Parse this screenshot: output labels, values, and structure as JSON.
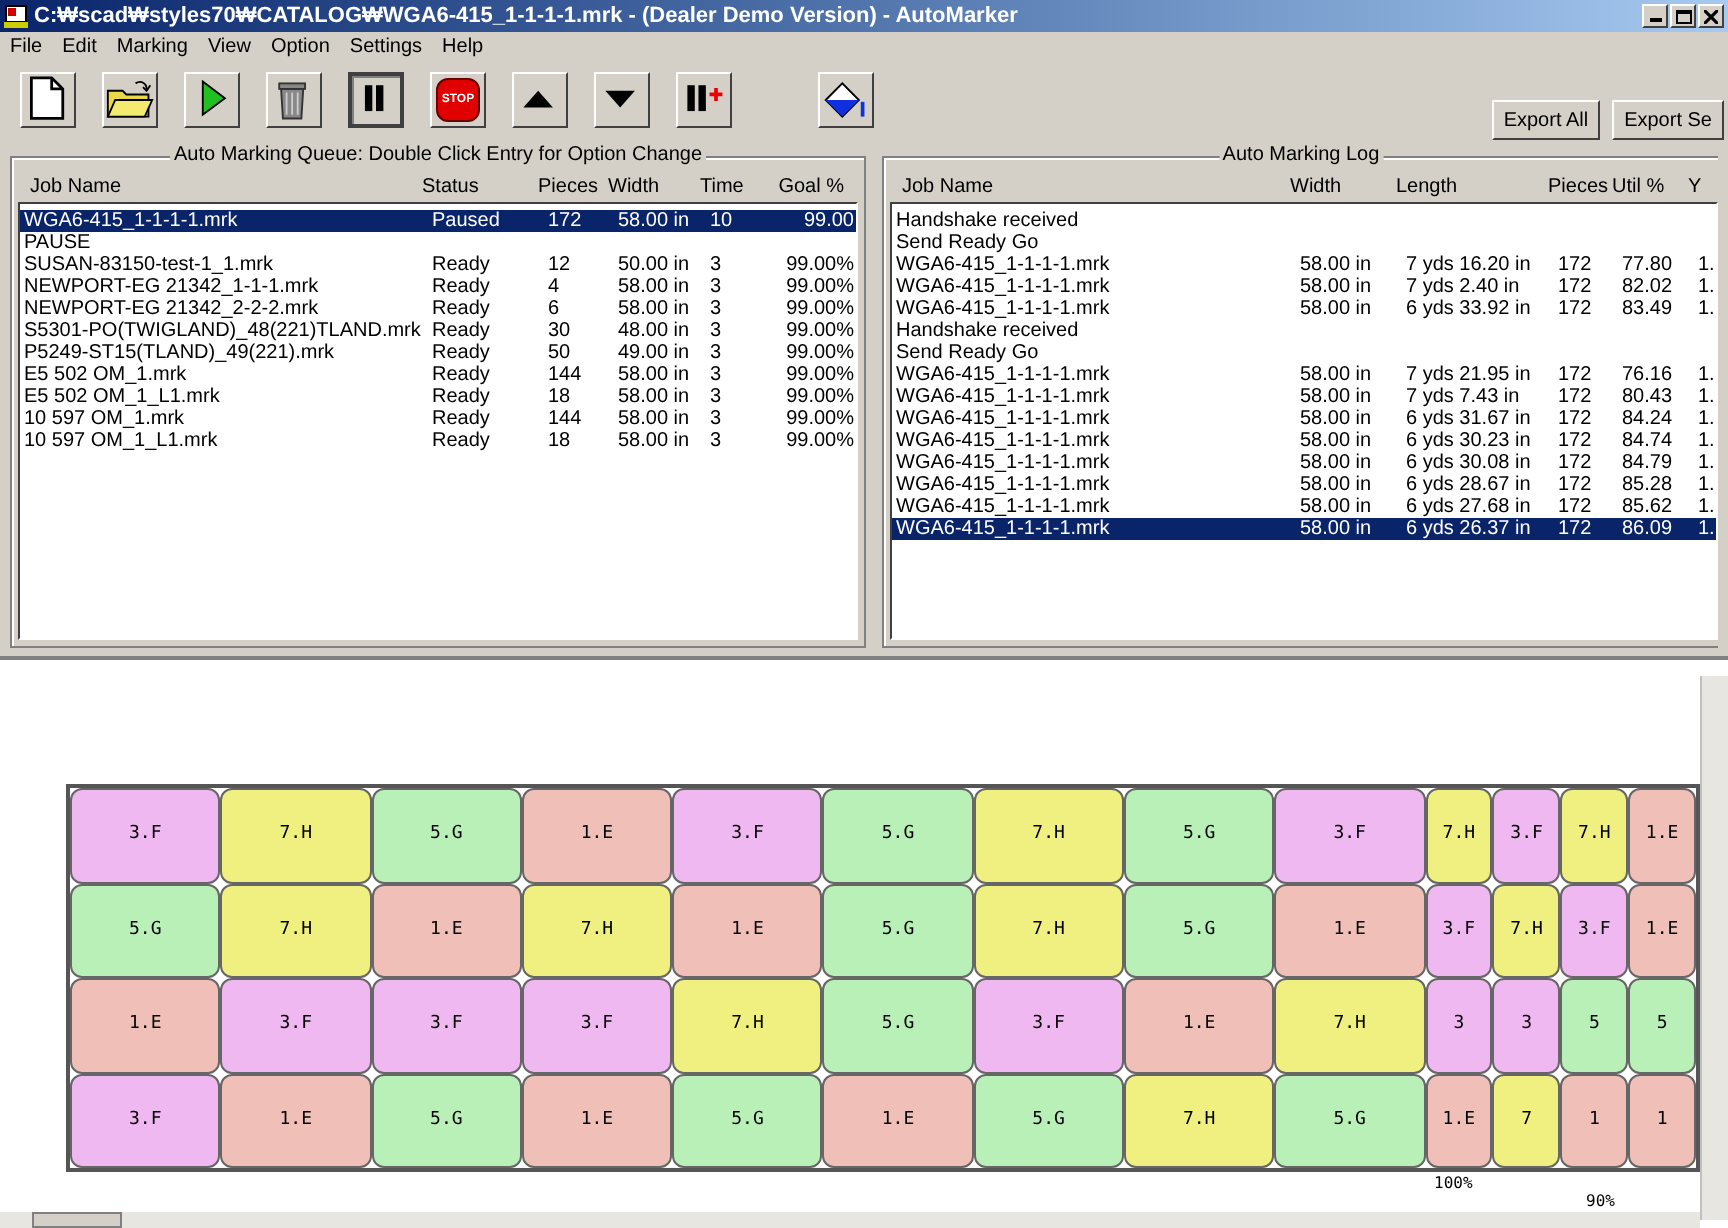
{
  "window": {
    "title": "C:₩scad₩styles70₩CATALOG₩WGA6-415_1-1-1-1.mrk - (Dealer Demo Version) - AutoMarker"
  },
  "menu": [
    "File",
    "Edit",
    "Marking",
    "View",
    "Option",
    "Settings",
    "Help"
  ],
  "toolbar": [
    {
      "kind": "new",
      "pressed": false
    },
    {
      "kind": "open",
      "pressed": false
    },
    {
      "kind": "play",
      "pressed": false
    },
    {
      "kind": "trash",
      "pressed": false
    },
    {
      "kind": "pause",
      "pressed": true
    },
    {
      "kind": "stop",
      "pressed": false,
      "label": "STOP"
    },
    {
      "kind": "up",
      "pressed": false
    },
    {
      "kind": "down",
      "pressed": false
    },
    {
      "kind": "pauseplus",
      "pressed": false
    },
    {
      "kind": "bucket",
      "pressed": false
    }
  ],
  "export_buttons": [
    "Export All",
    "Export Se"
  ],
  "queue": {
    "title": "Auto Marking Queue:  Double Click Entry for Option Change",
    "columns": [
      "Job Name",
      "Status",
      "Pieces",
      "Width",
      "Time",
      "Goal %"
    ],
    "rows": [
      {
        "kind": "job",
        "selected": true,
        "cells": [
          "WGA6-415_1-1-1-1.mrk",
          "Paused",
          "172",
          "58.00 in",
          "10",
          "99.00"
        ]
      },
      {
        "kind": "message",
        "selected": false,
        "cells": [
          "PAUSE"
        ]
      },
      {
        "kind": "job",
        "selected": false,
        "cells": [
          "SUSAN-83150-test-1_1.mrk",
          "Ready",
          "12",
          "50.00 in",
          "3",
          "99.00%"
        ]
      },
      {
        "kind": "job",
        "selected": false,
        "cells": [
          "NEWPORT-EG 21342_1-1-1.mrk",
          "Ready",
          "4",
          "58.00 in",
          "3",
          "99.00%"
        ]
      },
      {
        "kind": "job",
        "selected": false,
        "cells": [
          "NEWPORT-EG 21342_2-2-2.mrk",
          "Ready",
          "6",
          "58.00 in",
          "3",
          "99.00%"
        ]
      },
      {
        "kind": "job",
        "selected": false,
        "cells": [
          "S5301-PO(TWIGLAND)_48(221)TLAND.mrk",
          "Ready",
          "30",
          "48.00 in",
          "3",
          "99.00%"
        ]
      },
      {
        "kind": "job",
        "selected": false,
        "cells": [
          "P5249-ST15(TLAND)_49(221).mrk",
          "Ready",
          "50",
          "49.00 in",
          "3",
          "99.00%"
        ]
      },
      {
        "kind": "job",
        "selected": false,
        "cells": [
          "E5 502 OM_1.mrk",
          "Ready",
          "144",
          "58.00 in",
          "3",
          "99.00%"
        ]
      },
      {
        "kind": "job",
        "selected": false,
        "cells": [
          "E5 502 OM_1_L1.mrk",
          "Ready",
          "18",
          "58.00 in",
          "3",
          "99.00%"
        ]
      },
      {
        "kind": "job",
        "selected": false,
        "cells": [
          "10 597 OM_1.mrk",
          "Ready",
          "144",
          "58.00 in",
          "3",
          "99.00%"
        ]
      },
      {
        "kind": "job",
        "selected": false,
        "cells": [
          "10 597 OM_1_L1.mrk",
          "Ready",
          "18",
          "58.00 in",
          "3",
          "99.00%"
        ]
      }
    ]
  },
  "log": {
    "title": "Auto Marking Log",
    "columns": [
      "Job Name",
      "Width",
      "Length",
      "Pieces",
      "Util %",
      "Y"
    ],
    "rows": [
      {
        "kind": "message",
        "selected": false,
        "cells": [
          "Handshake received"
        ]
      },
      {
        "kind": "message",
        "selected": false,
        "cells": [
          "Send Ready Go"
        ]
      },
      {
        "kind": "job",
        "selected": false,
        "cells": [
          "WGA6-415_1-1-1-1.mrk",
          "58.00 in",
          "7 yds 16.20 in",
          "172",
          "77.80",
          "1."
        ]
      },
      {
        "kind": "job",
        "selected": false,
        "cells": [
          "WGA6-415_1-1-1-1.mrk",
          "58.00 in",
          "7 yds 2.40 in",
          "172",
          "82.02",
          "1."
        ]
      },
      {
        "kind": "job",
        "selected": false,
        "cells": [
          "WGA6-415_1-1-1-1.mrk",
          "58.00 in",
          "6 yds 33.92 in",
          "172",
          "83.49",
          "1."
        ]
      },
      {
        "kind": "message",
        "selected": false,
        "cells": [
          "Handshake received"
        ]
      },
      {
        "kind": "message",
        "selected": false,
        "cells": [
          "Send Ready Go"
        ]
      },
      {
        "kind": "job",
        "selected": false,
        "cells": [
          "WGA6-415_1-1-1-1.mrk",
          "58.00 in",
          "7 yds 21.95 in",
          "172",
          "76.16",
          "1."
        ]
      },
      {
        "kind": "job",
        "selected": false,
        "cells": [
          "WGA6-415_1-1-1-1.mrk",
          "58.00 in",
          "7 yds 7.43 in",
          "172",
          "80.43",
          "1."
        ]
      },
      {
        "kind": "job",
        "selected": false,
        "cells": [
          "WGA6-415_1-1-1-1.mrk",
          "58.00 in",
          "6 yds 31.67 in",
          "172",
          "84.24",
          "1."
        ]
      },
      {
        "kind": "job",
        "selected": false,
        "cells": [
          "WGA6-415_1-1-1-1.mrk",
          "58.00 in",
          "6 yds 30.23 in",
          "172",
          "84.74",
          "1."
        ]
      },
      {
        "kind": "job",
        "selected": false,
        "cells": [
          "WGA6-415_1-1-1-1.mrk",
          "58.00 in",
          "6 yds 30.08 in",
          "172",
          "84.79",
          "1."
        ]
      },
      {
        "kind": "job",
        "selected": false,
        "cells": [
          "WGA6-415_1-1-1-1.mrk",
          "58.00 in",
          "6 yds 28.67 in",
          "172",
          "85.28",
          "1."
        ]
      },
      {
        "kind": "job",
        "selected": false,
        "cells": [
          "WGA6-415_1-1-1-1.mrk",
          "58.00 in",
          "6 yds 27.68 in",
          "172",
          "85.62",
          "1."
        ]
      },
      {
        "kind": "job",
        "selected": true,
        "cells": [
          "WGA6-415_1-1-1-1.mrk",
          "58.00 in",
          "6 yds 26.37 in",
          "172",
          "86.09",
          "1."
        ]
      }
    ]
  },
  "marker": {
    "rows": [
      [
        {
          "label": "3.F",
          "color": "#f0b8f0"
        },
        {
          "label": "7.H",
          "color": "#f0f080"
        },
        {
          "label": "5.G",
          "color": "#b8f0b8"
        },
        {
          "label": "1.E",
          "color": "#f0c0b8"
        },
        {
          "label": "3.F",
          "color": "#f0b8f0"
        },
        {
          "label": "5.G",
          "color": "#b8f0b8"
        },
        {
          "label": "7.H",
          "color": "#f0f080"
        },
        {
          "label": "5.G",
          "color": "#b8f0b8"
        },
        {
          "label": "3.F",
          "color": "#f0b8f0"
        },
        {
          "label": "7.H",
          "color": "#f0f080"
        },
        {
          "label": "3.F",
          "color": "#f0b8f0"
        },
        {
          "label": "7.H",
          "color": "#f0f080"
        },
        {
          "label": "1.E",
          "color": "#f0c0b8"
        }
      ],
      [
        {
          "label": "5.G",
          "color": "#b8f0b8"
        },
        {
          "label": "7.H",
          "color": "#f0f080"
        },
        {
          "label": "1.E",
          "color": "#f0c0b8"
        },
        {
          "label": "7.H",
          "color": "#f0f080"
        },
        {
          "label": "1.E",
          "color": "#f0c0b8"
        },
        {
          "label": "5.G",
          "color": "#b8f0b8"
        },
        {
          "label": "7.H",
          "color": "#f0f080"
        },
        {
          "label": "5.G",
          "color": "#b8f0b8"
        },
        {
          "label": "1.E",
          "color": "#f0c0b8"
        },
        {
          "label": "3.F",
          "color": "#f0b8f0"
        },
        {
          "label": "7.H",
          "color": "#f0f080"
        },
        {
          "label": "3.F",
          "color": "#f0b8f0"
        },
        {
          "label": "1.E",
          "color": "#f0c0b8"
        }
      ],
      [
        {
          "label": "1.E",
          "color": "#f0c0b8"
        },
        {
          "label": "3.F",
          "color": "#f0b8f0"
        },
        {
          "label": "3.F",
          "color": "#f0b8f0"
        },
        {
          "label": "3.F",
          "color": "#f0b8f0"
        },
        {
          "label": "7.H",
          "color": "#f0f080"
        },
        {
          "label": "5.G",
          "color": "#b8f0b8"
        },
        {
          "label": "3.F",
          "color": "#f0b8f0"
        },
        {
          "label": "1.E",
          "color": "#f0c0b8"
        },
        {
          "label": "7.H",
          "color": "#f0f080"
        },
        {
          "label": "3",
          "color": "#f0b8f0"
        },
        {
          "label": "3",
          "color": "#f0b8f0"
        },
        {
          "label": "5",
          "color": "#b8f0b8"
        },
        {
          "label": "5",
          "color": "#b8f0b8"
        }
      ],
      [
        {
          "label": "3.F",
          "color": "#f0b8f0"
        },
        {
          "label": "1.E",
          "color": "#f0c0b8"
        },
        {
          "label": "5.G",
          "color": "#b8f0b8"
        },
        {
          "label": "1.E",
          "color": "#f0c0b8"
        },
        {
          "label": "5.G",
          "color": "#b8f0b8"
        },
        {
          "label": "1.E",
          "color": "#f0c0b8"
        },
        {
          "label": "5.G",
          "color": "#b8f0b8"
        },
        {
          "label": "7.H",
          "color": "#f0f080"
        },
        {
          "label": "5.G",
          "color": "#b8f0b8"
        },
        {
          "label": "1.E",
          "color": "#f0c0b8"
        },
        {
          "label": "7",
          "color": "#f0f080"
        },
        {
          "label": "1",
          "color": "#f0c0b8"
        },
        {
          "label": "1",
          "color": "#f0c0b8"
        }
      ]
    ],
    "ruler": [
      "100%",
      "90%"
    ]
  }
}
